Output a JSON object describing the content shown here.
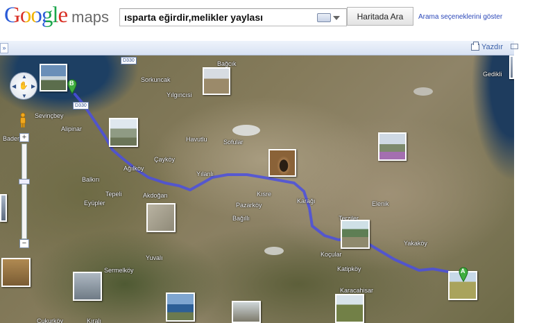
{
  "header": {
    "logo_google": "Google",
    "logo_maps": "maps",
    "search_value": "ısparta eğirdir,melikler yaylası",
    "search_button": "Haritada Ara",
    "options_link": "Arama seçeneklerini göster"
  },
  "toolbar": {
    "collapse_label": "»",
    "print_label": "Yazdır"
  },
  "map": {
    "markers": {
      "start": "A",
      "end": "B"
    },
    "road_shields": [
      "D330",
      "D330"
    ],
    "places": [
      "Bağcık",
      "Sorkuncak",
      "Yılgıncısi",
      "Sevinçbey",
      "Alipinar",
      "Baden",
      "Havutlu",
      "Sofular",
      "Çayköy",
      "Ağılköy",
      "Yılanlı",
      "Balkırı",
      "Tepeli",
      "Akdoğan",
      "Eyüpler",
      "Kısre",
      "Pazarköy",
      "Bağıllı",
      "Karağı",
      "Elenik",
      "Terziler",
      "Yakaköy",
      "Koçular",
      "Katipköy",
      "Yuvalı",
      "Sermelköy",
      "Karacahisar",
      "Çukurköy",
      "Kıralı",
      "Gedikli"
    ],
    "zoom": {
      "plus": "+",
      "minus": "−"
    }
  },
  "colors": {
    "route": "#4a4fe0",
    "link": "#2a47b8",
    "marker": "#3fae3f"
  }
}
